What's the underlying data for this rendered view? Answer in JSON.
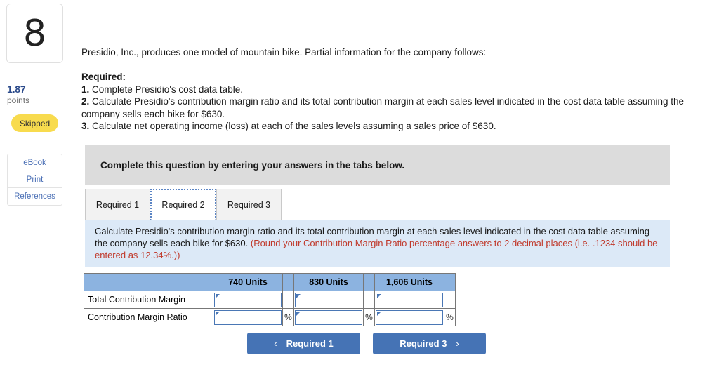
{
  "question": {
    "number": "8",
    "points_value": "1.87",
    "points_label": "points",
    "status_badge": "Skipped"
  },
  "rail_actions": [
    {
      "label": "eBook",
      "name": "ebook"
    },
    {
      "label": "Print",
      "name": "print"
    },
    {
      "label": "References",
      "name": "references"
    }
  ],
  "intro": "Presidio, Inc., produces one model of mountain bike. Partial information for the company follows:",
  "required": {
    "heading": "Required:",
    "items": [
      {
        "num": "1.",
        "text": " Complete Presidio's cost data table."
      },
      {
        "num": "2.",
        "text": " Calculate Presidio's contribution margin ratio and its total contribution margin at each sales level indicated in the cost data table assuming the company sells each bike for $630."
      },
      {
        "num": "3.",
        "text": " Calculate net operating income (loss) at each of the sales levels assuming a sales price of $630."
      }
    ]
  },
  "banner": {
    "text": "Complete this question by entering your answers in the tabs below."
  },
  "tabs": [
    {
      "label": "Required 1",
      "active": false
    },
    {
      "label": "Required 2",
      "active": true
    },
    {
      "label": "Required 3",
      "active": false
    }
  ],
  "instruction": {
    "main": "Calculate Presidio's contribution margin ratio and its total contribution margin at each sales level indicated in the cost data table assuming the company sells each bike for $630. ",
    "note": "(Round your Contribution Margin Ratio percentage answers to 2 decimal places (i.e. .1234 should be entered as 12.34%.))"
  },
  "table": {
    "columns": [
      "",
      "740 Units",
      "830 Units",
      "1,606 Units"
    ],
    "percent_symbol": "%",
    "rows": [
      {
        "label": "Total Contribution Margin",
        "values": [
          "",
          "",
          ""
        ],
        "has_percent": false
      },
      {
        "label": "Contribution Margin Ratio",
        "values": [
          "",
          "",
          ""
        ],
        "has_percent": true
      }
    ]
  },
  "nav": {
    "prev_label": "Required 1",
    "prev_chevron": "‹",
    "next_label": "Required 3",
    "next_chevron": "›"
  },
  "colors": {
    "accent_blue": "#4573b5",
    "table_header_blue": "#8cb3e0",
    "panel_blue": "#dce9f7",
    "banner_gray": "#dcdcdc",
    "badge_yellow": "#f8db4e",
    "note_red": "#c0392b",
    "points_blue": "#2c4b8b"
  }
}
